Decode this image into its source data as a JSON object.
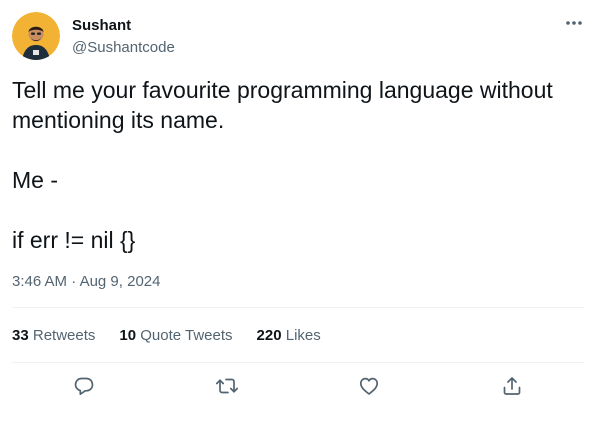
{
  "author": {
    "name": "Sushant",
    "handle": "@Sushantcode"
  },
  "tweet": {
    "lines": [
      "Tell me your favourite programming language without",
      "mentioning its name.",
      "",
      "Me -",
      "",
      "if err != nil {}"
    ],
    "time": "3:46 AM",
    "separator": "·",
    "date": "Aug 9, 2024"
  },
  "stats": {
    "retweets_count": "33",
    "retweets_label": "Retweets",
    "quotes_count": "10",
    "quotes_label": "Quote Tweets",
    "likes_count": "220",
    "likes_label": "Likes"
  },
  "icons": {
    "more": "more-horizontal-icon",
    "reply": "reply-icon",
    "retweet": "retweet-icon",
    "like": "heart-icon",
    "share": "share-icon"
  },
  "colors": {
    "text": "#0f1419",
    "secondary": "#536471",
    "divider": "#eff3f4",
    "avatar_bg": "#f2b233"
  }
}
